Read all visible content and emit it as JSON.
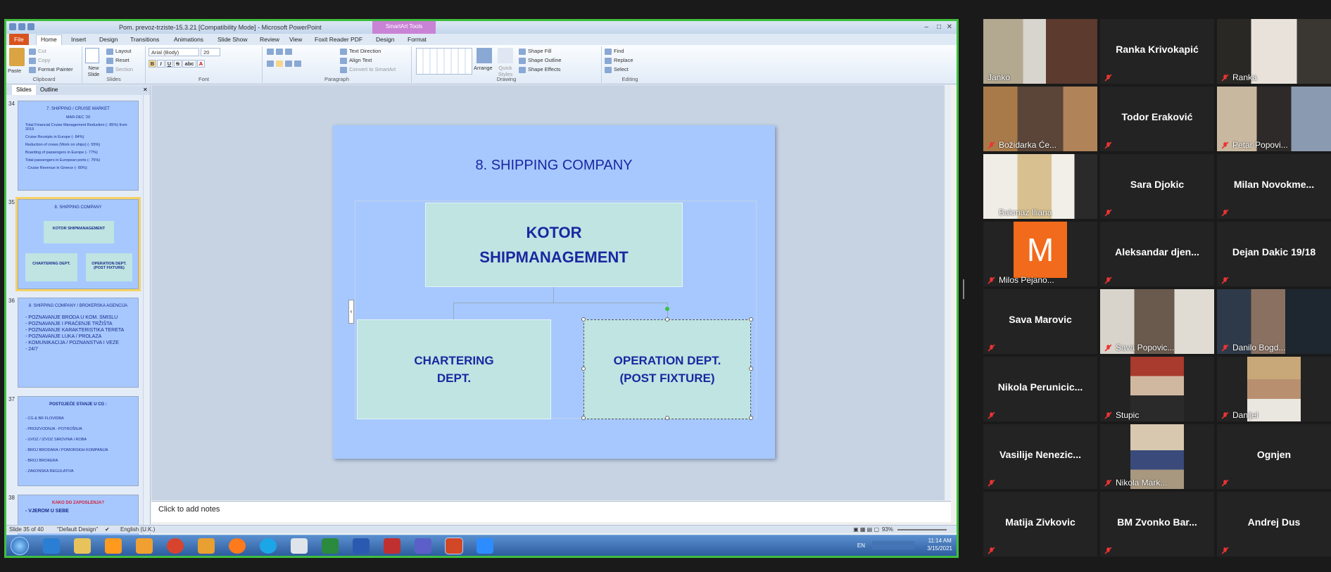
{
  "window": {
    "title": "Pom. prevoz-trziste-15.3.21 [Compatibility Mode] - Microsoft PowerPoint",
    "contextual_tab": "SmartArt Tools"
  },
  "tabs": [
    "File",
    "Home",
    "Insert",
    "Design",
    "Transitions",
    "Animations",
    "Slide Show",
    "Review",
    "View",
    "Foxit Reader PDF",
    "Design",
    "Format"
  ],
  "ribbon": {
    "clipboard": {
      "paste": "Paste",
      "cut": "Cut",
      "copy": "Copy",
      "format_painter": "Format Painter",
      "label": "Clipboard"
    },
    "slides": {
      "new_slide": "New Slide",
      "layout": "Layout",
      "reset": "Reset",
      "section": "Section",
      "label": "Slides"
    },
    "font": {
      "name": "Arial (Body)",
      "size": "20",
      "bold": "B",
      "italic": "I",
      "underline": "U",
      "strike": "S",
      "shadow": "abc",
      "label": "Font"
    },
    "paragraph": {
      "text_direction": "Text Direction",
      "align_text": "Align Text",
      "convert": "Convert to SmartArt",
      "label": "Paragraph"
    },
    "drawing": {
      "arrange": "Arrange",
      "quick_styles": "Quick Styles",
      "shape_fill": "Shape Fill",
      "shape_outline": "Shape Outline",
      "shape_effects": "Shape Effects",
      "label": "Drawing"
    },
    "editing": {
      "find": "Find",
      "replace": "Replace",
      "select": "Select",
      "label": "Editing"
    }
  },
  "left_pane": {
    "tabs": [
      "Slides",
      "Outline"
    ],
    "thumbs": [
      {
        "num": "34",
        "title": "7. SHIPPING / CRUISE MARKET",
        "sub": "MAR-DEC '20",
        "items": [
          "Total Financial Cruise Management Reduction (- 85%) from 2019",
          "Cruise Receipts in Europe (- 84%)",
          "Reduction of crews (Work on ships) (- 55%)",
          "Boarding of passengers in Europe (- 77%)",
          "Total passengers in European ports (- 75%)",
          "- Cruise Revenue in Greece (- 80%)"
        ]
      },
      {
        "num": "35",
        "title": "8. SHIPPING COMPANY",
        "top": "KOTOR SHIPMANAGEMENT",
        "left": "CHARTERING DEPT.",
        "right": "OPERATION DEPT. (POST FIXTURE)"
      },
      {
        "num": "36",
        "title": "8. SHIPPING COMPANY / BROKERSKA AGENCIJA",
        "items": [
          "- POZNAVANJE BRODA U KOM. SMISLU",
          "- POZNAVANJE I PRAĆENJE TRŽIŠTA",
          "- POZNAVANJE KARAKTERISTIKA TERETA",
          "- POZNAVANJE LUKA / PROLAZA",
          "- KOMUNIKACIJA / POZNANSTVA I VEZE",
          "- 24/7"
        ]
      },
      {
        "num": "37",
        "title": "POSTOJEĆE STANJE U CG :",
        "items": [
          "- CG & BR FLOVIDBA",
          "- PROIZVODNJA - POTROŠNJA",
          "- UVOZ / IZVOZ SIROVINA I ROBA",
          "- BROJ BRODARA / POMORSKIH KOMPANIJA",
          "- BROJ BROKERA",
          "- ZAKONSKA REGULATIVA"
        ]
      },
      {
        "num": "38",
        "title": "KAKO DO ZAPOSLENJA?",
        "items": [
          "- VJEROM U SEBE"
        ]
      }
    ]
  },
  "slide": {
    "title": "8. SHIPPING COMPANY",
    "top_line1": "KOTOR",
    "top_line2": "SHIPMANAGEMENT",
    "left_line1": "CHARTERING",
    "left_line2": "DEPT.",
    "right_line1": "OPERATION DEPT.",
    "right_line2": "(POST FIXTURE)"
  },
  "notes": "Click to add notes",
  "status": {
    "slide": "Slide 35 of 40",
    "theme": "\"Default Design\"",
    "lang": "English (U.K.)",
    "zoom": "93%"
  },
  "tray": {
    "lang": "EN",
    "time": "11:14 AM",
    "date": "3/15/2021"
  },
  "participants": [
    {
      "name": "Janko",
      "video": true,
      "speaker": true
    },
    {
      "name": "Ranka Krivokapić",
      "video": false
    },
    {
      "name": "Ranka",
      "video": true
    },
    {
      "name": "Božidarka Će...",
      "video": true
    },
    {
      "name": "Todor Eraković",
      "video": false
    },
    {
      "name": "Petar Popovi...",
      "video": true
    },
    {
      "name": "Bakmaz Iliana",
      "video": true
    },
    {
      "name": "Sara Djokic",
      "video": false
    },
    {
      "name": "Milan Novokme...",
      "video": false
    },
    {
      "name": "Milos Pejano...",
      "video": false,
      "avatar": "M"
    },
    {
      "name": "Aleksandar djen...",
      "video": false
    },
    {
      "name": "Dejan Dakic 19/18",
      "video": false
    },
    {
      "name": "Sava Marovic",
      "video": false
    },
    {
      "name": "Sava Popovic...",
      "video": true
    },
    {
      "name": "Danilo Bogd...",
      "video": true
    },
    {
      "name": "Nikola Perunicic...",
      "video": false
    },
    {
      "name": "Stupic",
      "video": true
    },
    {
      "name": "Danijel",
      "video": true
    },
    {
      "name": "Vasilije Nenezic...",
      "video": false
    },
    {
      "name": "Nikola Mark...",
      "video": true
    },
    {
      "name": "Ognjen",
      "video": false
    },
    {
      "name": "Matija Zivkovic",
      "video": false
    },
    {
      "name": "BM Zvonko Bar...",
      "video": false
    },
    {
      "name": "Andrej Dus",
      "video": false
    }
  ],
  "colors": {
    "slide_bg": "#a6c8ff",
    "box_fill": "#bfe4e2",
    "text_blue": "#1a27a0",
    "share_border": "#3fbf3f",
    "speaker": "#d5dc2b",
    "avatar": "#f26a1b"
  }
}
